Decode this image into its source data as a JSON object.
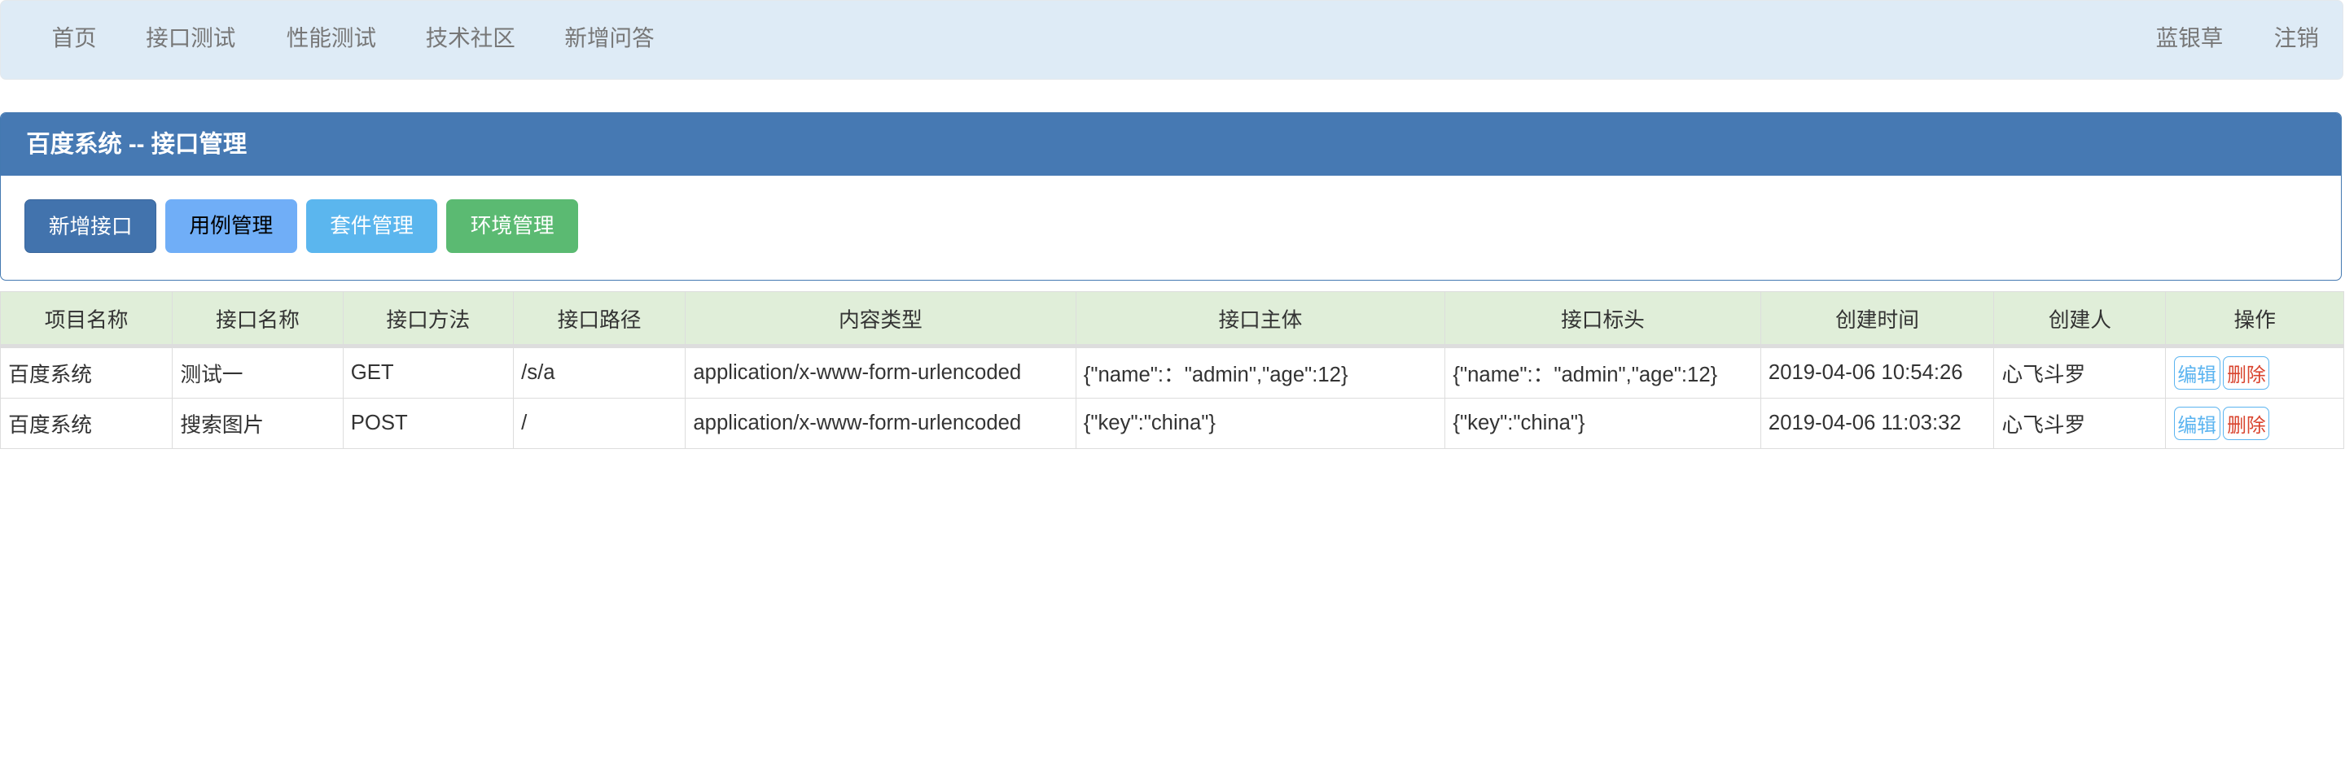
{
  "nav": {
    "items": [
      "首页",
      "接口测试",
      "性能测试",
      "技术社区",
      "新增问答"
    ],
    "user": "蓝银草",
    "logout": "注销"
  },
  "panel": {
    "title": "百度系统 -- 接口管理",
    "buttons": [
      "新增接口",
      "用例管理",
      "套件管理",
      "环境管理"
    ]
  },
  "table": {
    "headers": [
      "项目名称",
      "接口名称",
      "接口方法",
      "接口路径",
      "内容类型",
      "接口主体",
      "接口标头",
      "创建时间",
      "创建人",
      "操作"
    ],
    "rows": [
      [
        "百度系统",
        "测试一",
        "GET",
        "/s/a",
        "application/x-www-form-urlencoded",
        "{\"name\":：\"admin\",\"age\":12}",
        "{\"name\":：\"admin\",\"age\":12}",
        "2019-04-06 10:54:26",
        "心飞斗罗"
      ],
      [
        "百度系统",
        "搜索图片",
        "POST",
        "/",
        "application/x-www-form-urlencoded",
        "{\"key\":\"china\"}",
        "{\"key\":\"china\"}",
        "2019-04-06 11:03:32",
        "心飞斗罗"
      ]
    ],
    "edit": "编辑",
    "delete": "删除"
  },
  "colors": {
    "primary": "#4679b3",
    "info": "#5bc0de",
    "success": "#5cb85c",
    "header_bg": "#e0eed9",
    "nav_bg": "#deebf6"
  }
}
